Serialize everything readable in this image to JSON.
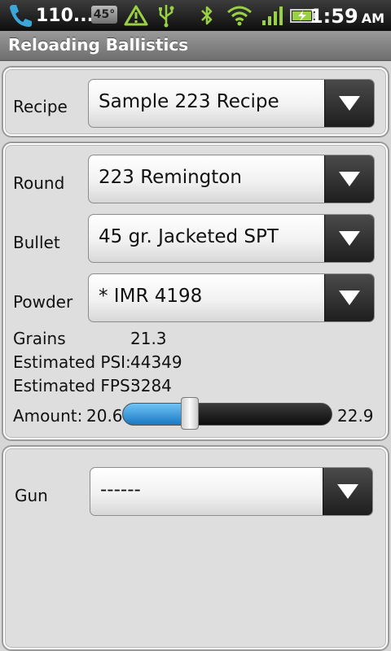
{
  "status_bar": {
    "signal_text": "110...",
    "temperature": "45°",
    "time": "1:59",
    "ampm": "AM",
    "icons": [
      "phone-icon",
      "weather-temp-badge",
      "warning-icon",
      "usb-icon",
      "bluetooth-icon",
      "wifi-icon",
      "signal-bars-icon",
      "battery-charging-icon"
    ]
  },
  "app": {
    "title": "Reloading Ballistics"
  },
  "recipe": {
    "label": "Recipe",
    "value": "Sample 223 Recipe"
  },
  "load": {
    "round": {
      "label": "Round",
      "value": "223 Remington"
    },
    "bullet": {
      "label": "Bullet",
      "value": "45 gr. Jacketed SPT"
    },
    "powder": {
      "label": "Powder",
      "value": "* IMR 4198"
    },
    "grains": {
      "label": "Grains",
      "value": "21.3"
    },
    "psi": {
      "label": "Estimated PSI:",
      "value": "44349"
    },
    "fps": {
      "label": "Estimated FPS:",
      "value": "3284"
    },
    "amount": {
      "label": "Amount:",
      "min": "20.6",
      "max": "22.9",
      "fraction": 0.32
    }
  },
  "gun": {
    "label": "Gun",
    "value": "------"
  },
  "colors": {
    "slider_fill": "#2a8ad8",
    "status_icon_green": "#9ad144"
  }
}
